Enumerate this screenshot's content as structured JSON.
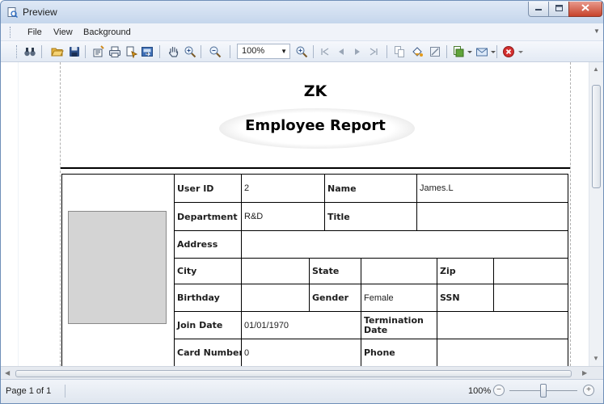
{
  "window": {
    "title": "Preview"
  },
  "menu": {
    "items": [
      "File",
      "View",
      "Background"
    ]
  },
  "toolbar": {
    "zoom_value": "100%"
  },
  "report": {
    "company": "ZK",
    "title": "Employee Report",
    "labels": {
      "user_id": "User ID",
      "name": "Name",
      "department": "Department",
      "title": "Title",
      "address": "Address",
      "city": "City",
      "state": "State",
      "zip": "Zip",
      "birthday": "Birthday",
      "gender": "Gender",
      "ssn": "SSN",
      "join_date": "Join Date",
      "termination_date": "Termination Date",
      "card_number": "Card Number",
      "phone": "Phone"
    },
    "values": {
      "user_id": "2",
      "name": "James.L",
      "department": "R&D",
      "title": "",
      "address": "",
      "city": "",
      "state": "",
      "zip": "",
      "birthday": "",
      "gender": "Female",
      "ssn": "",
      "join_date": "01/01/1970",
      "termination_date": "",
      "card_number": "0",
      "phone": ""
    }
  },
  "status": {
    "page": "Page 1 of 1",
    "zoom": "100%"
  },
  "icons": [
    "preview-app-icon",
    "minimize-icon",
    "maximize-icon",
    "close-icon",
    "find-icon",
    "open-icon",
    "save-icon",
    "page-setup-icon",
    "print-icon",
    "quick-print-icon",
    "export-icon",
    "hand-tool-icon",
    "zoom-in-icon",
    "zoom-out-icon",
    "first-page-icon",
    "previous-page-icon",
    "next-page-icon",
    "last-page-icon",
    "multiple-pages-icon",
    "background-color-icon",
    "watermark-icon",
    "export-document-icon",
    "send-email-icon",
    "exit-icon"
  ],
  "colors": {
    "accent": "#1f4e9e",
    "exit": "#d32f2f",
    "photo_placeholder": "#d4d4d4"
  }
}
